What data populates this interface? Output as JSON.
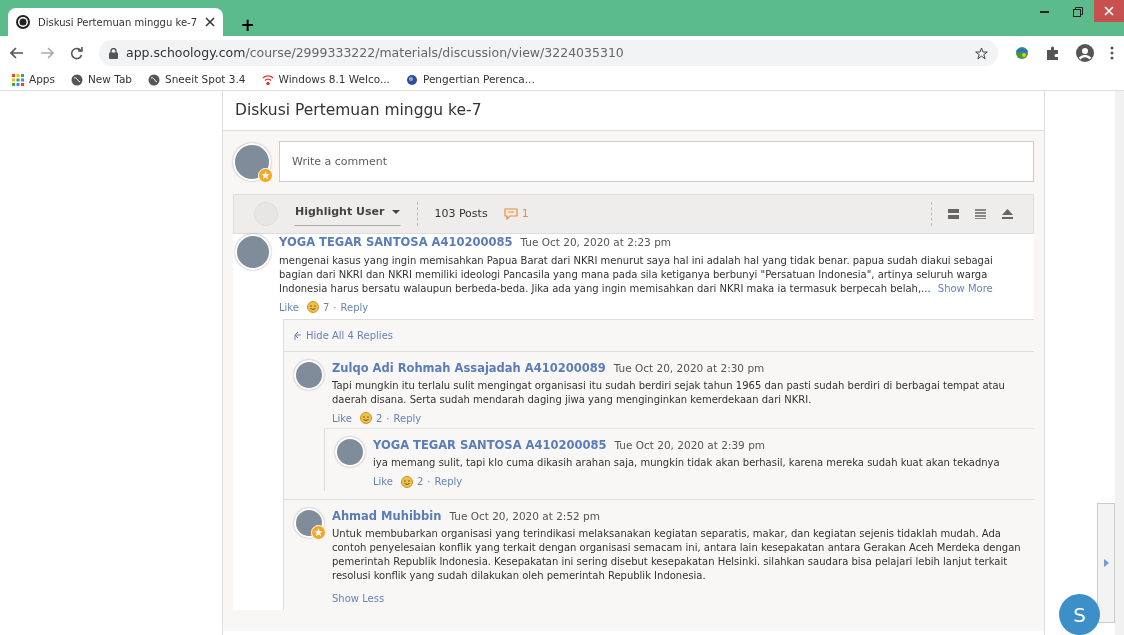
{
  "browser": {
    "tab_title": "Diskusi Pertemuan minggu ke-7",
    "new_tab": "+",
    "url_host": "app.schoology.com",
    "url_path": "/course/2999333222/materials/discussion/view/3224035310",
    "bookmarks": [
      {
        "label": "Apps",
        "kind": "apps"
      },
      {
        "label": "New Tab",
        "kind": "globe"
      },
      {
        "label": "Sneeit Spot 3.4",
        "kind": "globe"
      },
      {
        "label": "Windows 8.1 Welco...",
        "kind": "wifi"
      },
      {
        "label": "Pengertian Perenca...",
        "kind": "earth"
      }
    ]
  },
  "discussion": {
    "title": "Diskusi Pertemuan minggu ke-7",
    "comment_placeholder": "Write a comment",
    "highlight_label": "Highlight User",
    "posts_count": "103 Posts",
    "comment_count": "1",
    "comments": [
      {
        "author": "YOGA TEGAR SANTOSA A410200085",
        "time": "Tue Oct 20, 2020 at 2:23 pm",
        "badge": false,
        "text": "mengenai kasus yang ingin memisahkan Papua Barat dari NKRI menurut saya hal ini adalah hal yang tidak benar. papua sudah diakui sebagai bagian dari NKRI dan NKRI memiliki ideologi Pancasila yang mana pada sila ketiganya berbunyi \"Persatuan Indonesia\", artinya seluruh warga Indonesia harus bersatu walaupun berbeda-beda. Jika ada yang ingin memisahkan dari NKRI maka ia termasuk berpecah belah,...",
        "more": "Show More",
        "like": "Like",
        "likes": "7",
        "dot": "·",
        "reply": "Reply",
        "toggle": "Hide All 4 Replies",
        "children": [
          {
            "author": "Zulqo Adi Rohmah Assajadah A410200089",
            "time": "Tue Oct 20, 2020 at 2:30 pm",
            "badge": false,
            "text": "Tapi mungkin itu terlalu sulit mengingat organisasi itu sudah berdiri sejak tahun 1965 dan pasti sudah berdiri di berbagai tempat atau daerah disana. Serta sudah mendarah daging jiwa yang menginginkan kemerdekaan dari NKRI.",
            "like": "Like",
            "likes": "2",
            "dot": "·",
            "reply": "Reply",
            "children": [
              {
                "author": "YOGA TEGAR SANTOSA A410200085",
                "time": "Tue Oct 20, 2020 at 2:39 pm",
                "badge": false,
                "text": "iya memang sulit, tapi klo cuma dikasih arahan saja, mungkin tidak akan berhasil, karena mereka sudah kuat akan tekadnya",
                "like": "Like",
                "likes": "2",
                "dot": "·",
                "reply": "Reply"
              }
            ]
          },
          {
            "author": "Ahmad Muhibbin",
            "time": "Tue Oct 20, 2020 at 2:52 pm",
            "badge": true,
            "text": "Untuk membubarkan organisasi yang terindikasi melaksanakan kegiatan separatis, makar, dan kegiatan sejenis tidaklah mudah. Ada contoh penyelesaian konflik yang terkait dengan organisasi semacam ini, antara lain kesepakatan antara Gerakan Aceh Merdeka dengan pemerintah Republik Indonesia. Kesepakatan ini sering disebut kesepakatan Helsinki. silahkan saudara bisa pelajari lebih lanjut terkait resolusi konflik yang sudah dilakukan oleh pemerintah Republik Indonesia.",
            "less": "Show Less"
          }
        ]
      }
    ]
  },
  "chat_button": "S"
}
